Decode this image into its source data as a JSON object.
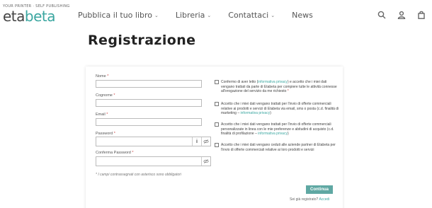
{
  "header": {
    "logo_tagline": "YOUR PRINTER · SELF PUBLISHING",
    "logo_part1": "eta",
    "logo_part2": "beta",
    "nav": [
      {
        "label": "Pubblica il tuo libro",
        "has_dropdown": true
      },
      {
        "label": "Libreria",
        "has_dropdown": true
      },
      {
        "label": "Contattaci",
        "has_dropdown": true
      },
      {
        "label": "News",
        "has_dropdown": false
      }
    ],
    "icons": [
      "search-icon",
      "user-icon",
      "bag-icon"
    ]
  },
  "page_title": "Registrazione",
  "form": {
    "fields": [
      {
        "label": "Nome",
        "required_mark": "*",
        "value": ""
      },
      {
        "label": "Cognome",
        "required_mark": "*",
        "value": ""
      },
      {
        "label": "Email",
        "required_mark": "*",
        "value": ""
      }
    ],
    "password_label": "Password",
    "confirm_password_label": "Conferma Password",
    "required_mark": "*",
    "info_glyph": "i",
    "required_note": "* I campi contrassegnati con asterisco sono obbligatori",
    "consents": [
      {
        "pre": "Confermo di aver letto (",
        "link": "informativa privacy",
        "post": ") e accetto che i miei dati vengano trattati da parte di Etabeta per compiere tutte le attività connesse all'erogazione del servizio da me richiesto",
        "mark": " *"
      },
      {
        "pre": "Accetto che i miei dati vengano trattati per l'invio di offerte commerciali relative ai prodotti e servizi di Etabeta via email, sms o posta (c.d. finalità di marketing – ",
        "link": "informativa privacy",
        "post": ")",
        "mark": ""
      },
      {
        "pre": "Accetto che i miei dati vengano trattati per l'invio di offerte commerciali personalizzate in linea con le mie preferenze e abitudini di acquisto (c.d. finalità di profilazione – ",
        "link": "informativa privacy",
        "post": ")",
        "mark": ""
      },
      {
        "pre": "Accetto che i miei dati vengano ceduti alle aziende partner di Etabeta per l'invio di offerte commerciali relative ai loro prodotti e servizi",
        "link": "",
        "post": "",
        "mark": ""
      }
    ],
    "submit_label": "Continua",
    "login_prompt": "Sei già registrato?",
    "login_link": "Accedi"
  },
  "colors": {
    "accent": "#3aa6a0",
    "button": "#5fa8a3"
  }
}
